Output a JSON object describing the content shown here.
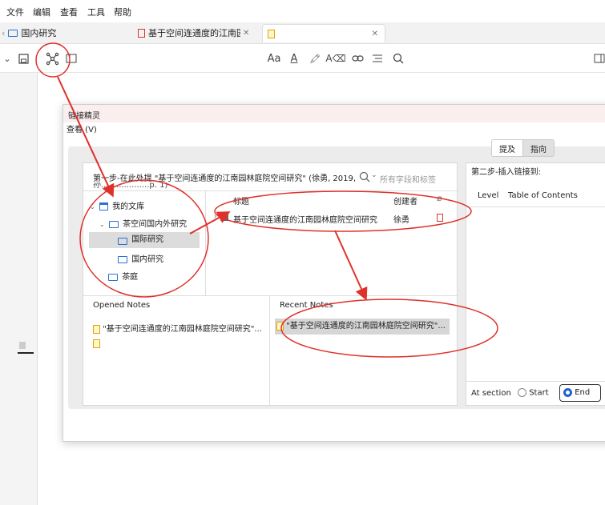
{
  "menu": [
    "文件",
    "编辑",
    "查看",
    "工具",
    "帮助"
  ],
  "tabs": [
    {
      "label": "国内研究"
    },
    {
      "label": "基于空间连通度的江南园林",
      "close": "✕"
    },
    {
      "label": "",
      "close": "✕"
    }
  ],
  "dialog": {
    "title": "链接精灵",
    "menu": "查看 (V)",
    "mode_left": "提及",
    "mode_right": "指向",
    "step1": "第一步-在此处提 \"基于空间连通度的江南园林庭院空间研究\" (徐勇, 2019,",
    "step1_cont": "孙...................p. 1)",
    "search_placeholder": "所有字段和标签",
    "tree": [
      {
        "label": "我的文库"
      },
      {
        "label": "茶空间国内外研究"
      },
      {
        "label": "国际研究"
      },
      {
        "label": "国内研究"
      },
      {
        "label": "茶庭"
      }
    ],
    "table_headers": {
      "title": "标题",
      "creator": "创建者"
    },
    "rows": [
      {
        "title": "基于空间连通度的江南园林庭院空间研究",
        "creator": "徐勇"
      }
    ],
    "opened_notes_label": "Opened Notes",
    "recent_notes_label": "Recent Notes",
    "opened_note": "\"基于空间连通度的江南园林庭院空间研究\"...",
    "recent_note": "\"基于空间连通度的江南园林庭院空间研究\"...",
    "step2": "第二步-插入链接到:",
    "col_level": "Level",
    "col_toc": "Table of Contents",
    "at_section": "At section",
    "start_label": "Start",
    "end_label": "End"
  },
  "colors": {
    "accent": "#1e62d0",
    "annotation": "#e0302a",
    "dialog_title_bg": "#fbeeee"
  }
}
